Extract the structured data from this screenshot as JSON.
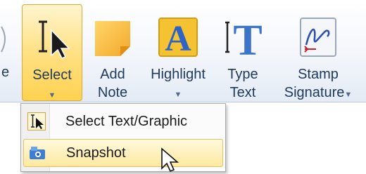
{
  "ribbon": {
    "partial_left_label": "e",
    "select": {
      "label": "Select",
      "arrow": "▼"
    },
    "add_note": {
      "line1": "Add",
      "line2": "Note"
    },
    "highlight": {
      "label": "Highlight",
      "arrow": "▼"
    },
    "type_text": {
      "line1": "Type",
      "line2": "Text"
    },
    "stamp": {
      "line1": "Stamp",
      "line2": "Signature",
      "arrow": "▼"
    }
  },
  "select_menu": {
    "items": [
      {
        "label": "Select Text/Graphic",
        "icon": "text-select-cursor-icon"
      },
      {
        "label": "Snapshot",
        "icon": "snapshot-camera-icon",
        "highlighted": true
      }
    ]
  },
  "colors": {
    "ribbon_text": "#1e395b",
    "selected_gradient_top": "#fff5cf",
    "selected_gradient_bottom": "#ffd14f"
  }
}
